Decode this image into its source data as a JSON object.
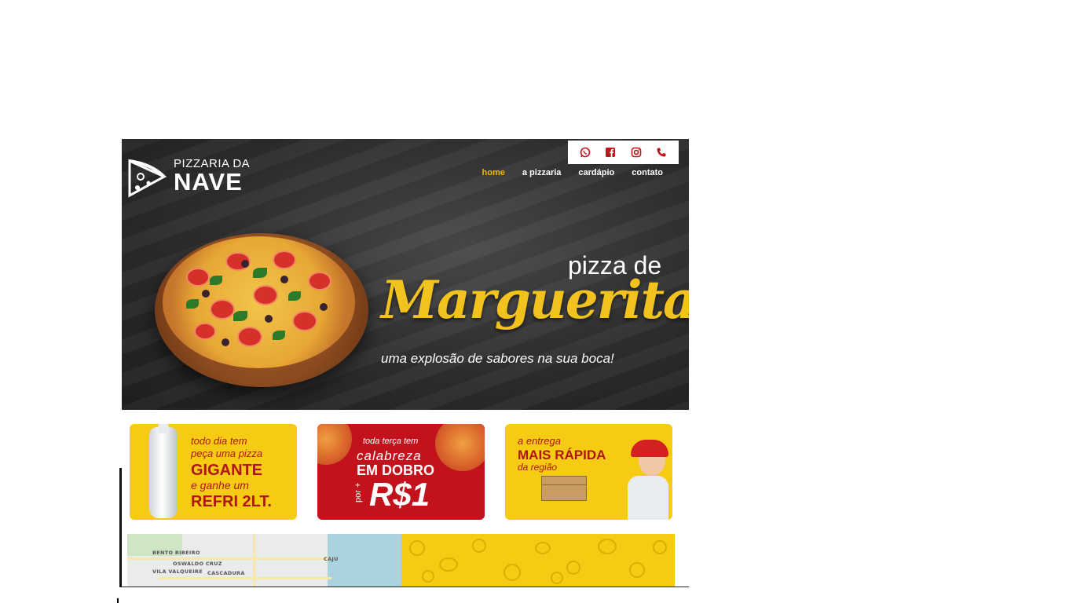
{
  "brand": {
    "logo_top": "PIZZARIA DA",
    "logo_main": "NAVE"
  },
  "social": {
    "icons": [
      "whatsapp-icon",
      "facebook-icon",
      "instagram-icon",
      "phone-icon"
    ],
    "icon_color": "#c3121b"
  },
  "nav": {
    "items": [
      {
        "label": "home",
        "active": true
      },
      {
        "label": "a pizzaria",
        "active": false
      },
      {
        "label": "cardápio",
        "active": false
      },
      {
        "label": "contato",
        "active": false
      }
    ],
    "active_color": "#f2b600"
  },
  "hero": {
    "line1": "pizza de",
    "headline": "Marguerita",
    "tagline": "uma explosão de sabores na sua boca!"
  },
  "banners": [
    {
      "line1": "todo dia tem",
      "line2": "peça uma pizza",
      "line3": "GIGANTE",
      "line4": "e ganhe um",
      "line5": "REFRI 2LT."
    },
    {
      "line1": "toda terça tem",
      "line2": "calabreza",
      "line3": "EM DOBRO",
      "line4": "por +",
      "line5": "R$1"
    },
    {
      "line1": "a entrega",
      "line2": "MAIS RÁPIDA",
      "line3": "da região"
    }
  ],
  "map": {
    "labels": [
      "BENTO RIBEIRO",
      "OSWALDO CRUZ",
      "VILA VALQUEIRE",
      "CASCADURA",
      "CAJU"
    ]
  },
  "colors": {
    "accent_yellow": "#f5cc13",
    "accent_red": "#c3121b",
    "hero_bg": "#2e2e2e"
  }
}
